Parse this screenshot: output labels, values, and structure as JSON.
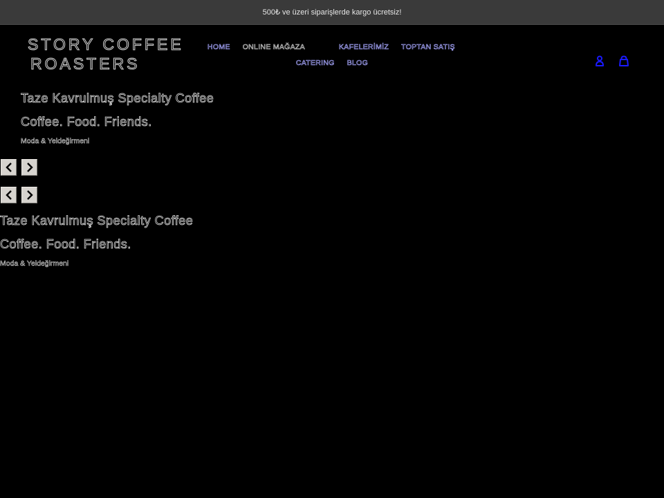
{
  "announcement": {
    "text": "500₺ ve üzeri siparişlerde kargo ücretsiz!"
  },
  "logo": {
    "line1": "STORY COFFEE",
    "line2": "ROASTERS"
  },
  "nav": {
    "row1": [
      {
        "label": "HOME",
        "name": "nav-home"
      },
      {
        "label": "ONLINE MAĞAZA",
        "name": "nav-online-magaza"
      },
      {
        "label": "KAFELERİMİZ",
        "name": "nav-kafelerimiz"
      },
      {
        "label": "TOPTAN SATIŞ",
        "name": "nav-toptan-satis"
      }
    ],
    "row2": [
      {
        "label": "CATERING",
        "name": "nav-catering"
      },
      {
        "label": "BLOG",
        "name": "nav-blog"
      }
    ]
  },
  "header_icons": {
    "account": "account-icon",
    "cart": "cart-icon",
    "color": "#1a1aff"
  },
  "hero_slides": [
    {
      "title": "Taze Kavrulmuş Specialty Coffee",
      "subtitle": "Coffee. Food. Friends.",
      "location": "Moda & Yeldeğirmeni"
    },
    {
      "title": "Taze Kavrulmuş Specialty Coffee",
      "subtitle": "Coffee. Food. Friends.",
      "location": "Moda & Yeldeğirmeni"
    }
  ],
  "slider_controls": {
    "prev": "chevron-left-icon",
    "next": "chevron-right-icon"
  }
}
